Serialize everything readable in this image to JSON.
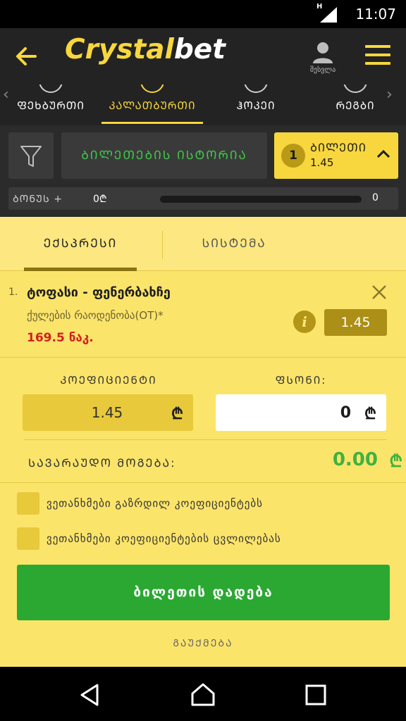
{
  "status_bar": {
    "time": "11:07",
    "network": "H"
  },
  "header": {
    "logo_part1": "Crystal",
    "logo_part2": "bet",
    "login_label": "შესვლა"
  },
  "sports_nav": {
    "items": [
      {
        "label": "ᲤᲔᲮᲑᲣᲠᲗᲘ",
        "icon": "football-icon",
        "active": false
      },
      {
        "label": "ᲙᲐᲚᲐᲗᲑᲣᲠᲗᲘ",
        "icon": "basketball-icon",
        "active": true
      },
      {
        "label": "ᲰᲝᲙᲔᲘ",
        "icon": "hockey-icon",
        "active": false
      },
      {
        "label": "ᲠᲔᲒᲑᲘ",
        "icon": "rugby-icon",
        "active": false
      }
    ]
  },
  "betslip_bar": {
    "history_label": "ᲑᲘᲚᲔᲗᲔᲑᲘᲡ ᲘᲡᲢᲝᲠᲘᲐ",
    "ticket_count": "1",
    "ticket_label": "ᲑᲘᲚᲔᲗᲘ",
    "ticket_odds": "1.45",
    "bonus_label": "ᲑᲝᲜᲣᲡ +",
    "bonus_start": "0₾",
    "bonus_end": "0",
    "bonus_progress": 0
  },
  "betslip": {
    "tabs": [
      {
        "label": "ᲔᲥᲡᲞᲠᲔᲡᲘ",
        "active": true
      },
      {
        "label": "ᲡᲘᲡᲢᲔᲛᲐ",
        "active": false
      }
    ],
    "selection": {
      "number": "1.",
      "title": "ტოფასი - ფენერბახჩე",
      "market": "ქულების რაოდენობა(OT)*",
      "line": "169.5 ნაკ.",
      "odds": "1.45"
    },
    "coef_label": "ᲙᲝᲔᲤᲘᲪᲘᲔᲜᲢᲘ",
    "coef_value": "1.45",
    "stake_label": "ᲤᲡᲝᲜᲘ:",
    "stake_value": "0",
    "currency": "₾",
    "win_label": "ᲡᲐᲕᲐᲠᲐᲣᲓᲝ ᲛᲝᲒᲔᲑᲐ:",
    "win_value": "0.00",
    "checks": [
      "ვეთანხმები გაზრდილ კოეფიციენტებს",
      "ვეთანხმები კოეფიციენტების ცვლილებას"
    ],
    "place_bet_label": "ბილეთის დადება",
    "cancel_label": "ᲒᲐᲣᲥᲛᲔᲑᲐ"
  },
  "colors": {
    "accent": "#f7d73d",
    "panel": "#fbe46a",
    "green": "#2aa832",
    "red": "#d32020"
  }
}
